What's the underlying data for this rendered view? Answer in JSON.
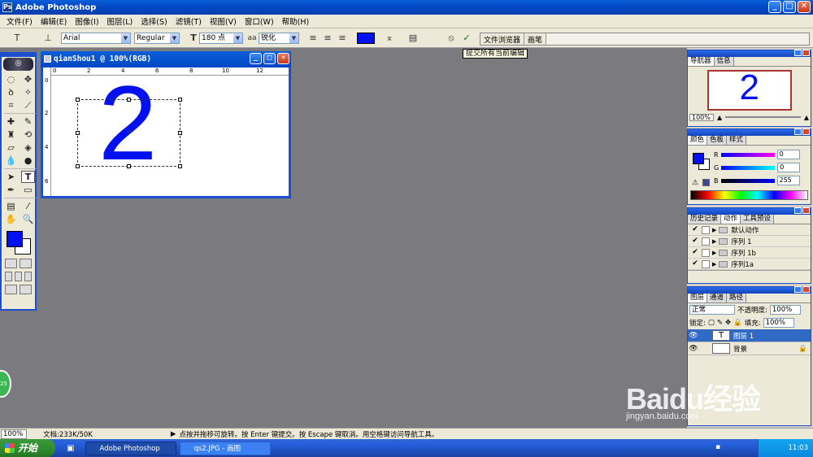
{
  "window": {
    "title": "Adobe Photoshop",
    "min": "_",
    "max": "□",
    "close": "✕"
  },
  "menu": [
    "文件(F)",
    "编辑(E)",
    "图像(I)",
    "图层(L)",
    "选择(S)",
    "滤镜(T)",
    "视图(V)",
    "窗口(W)",
    "帮助(H)"
  ],
  "options": {
    "font_family": "Arial",
    "font_style": "Regular",
    "font_size": "180 点",
    "antialias_label": "aa",
    "antialias": "锐化",
    "text_color": "#0010f0",
    "palette_tabs": [
      "文件浏览器",
      "画笔"
    ],
    "tooltip": "提交所有当前编辑"
  },
  "document": {
    "title": "qianShou1 @ 100%(RGB)",
    "content_text": "2",
    "ruler_numbers": [
      "0",
      "2",
      "4",
      "6",
      "8",
      "10",
      "12"
    ],
    "ruler_left_numbers": [
      "0",
      "2",
      "4",
      "6"
    ]
  },
  "toolbox": {
    "fg_color": "#0010f0",
    "bg_color": "#ffffff"
  },
  "navigator": {
    "tabs": [
      "导航器",
      "信息"
    ],
    "zoom": "100%",
    "thumb_text": "2"
  },
  "color_panel": {
    "tabs": [
      "颜色",
      "色板",
      "样式"
    ],
    "rows": [
      {
        "label": "R",
        "value": "0"
      },
      {
        "label": "G",
        "value": "0"
      },
      {
        "label": "B",
        "value": "255"
      }
    ]
  },
  "actions_panel": {
    "tabs": [
      "历史记录",
      "动作",
      "工具预设"
    ],
    "items": [
      "默认动作",
      "序列 1",
      "序列 1b",
      "序列1a"
    ]
  },
  "layers_panel": {
    "tabs": [
      "图层",
      "通道",
      "路径"
    ],
    "blend_mode": "正常",
    "opacity_label": "不透明度:",
    "opacity": "100%",
    "lock_label": "锁定:",
    "fill_label": "填充:",
    "fill": "100%",
    "layers": [
      {
        "name": "图层 1",
        "thumb": "T",
        "active": true
      },
      {
        "name": "背景",
        "thumb": "",
        "active": false
      }
    ]
  },
  "status": {
    "zoom": "100%",
    "doc": "文档:233K/50K",
    "hint": "点按并拖移可旋转。按 Enter 键提交。按 Escape 键取消。用空格键访问导航工具。"
  },
  "taskbar": {
    "start": "开始",
    "tasks": [
      "Adobe Photoshop",
      "qs2.JPG - 画图"
    ],
    "clock": "11:03"
  },
  "badge": "25",
  "watermark": {
    "line1": "Baidu经验",
    "line2": "jingyan.baidu.com"
  }
}
